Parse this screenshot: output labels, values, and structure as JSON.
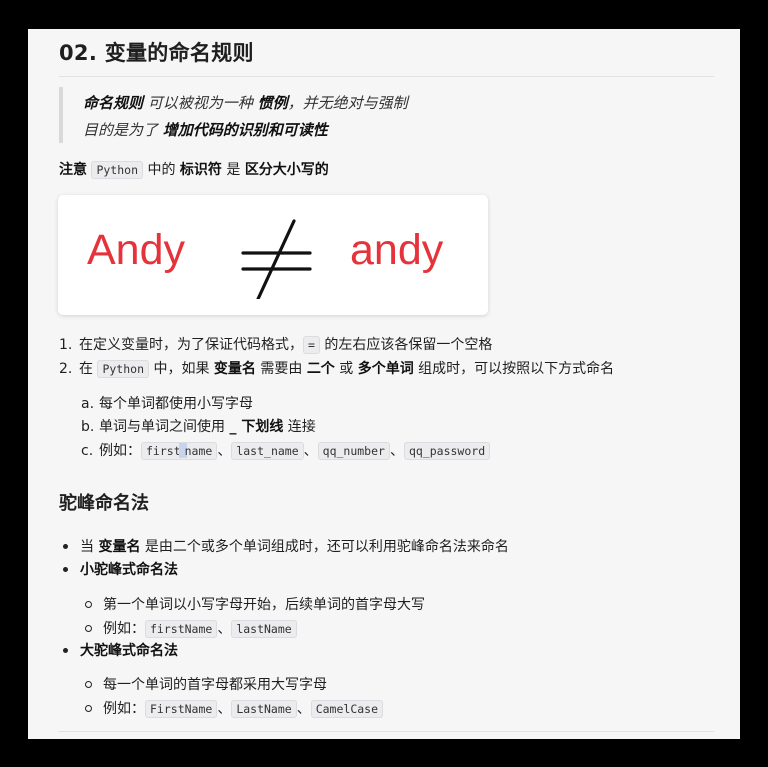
{
  "heading": "02. 变量的命名规则",
  "quote": {
    "l1_b1": "命名规则",
    "l1_t1": " 可以被视为一种 ",
    "l1_b2": "惯例",
    "l1_t2": "，并无绝对与强制",
    "l2_t1": "目的是为了 ",
    "l2_b1": "增加代码的识别和可读性"
  },
  "note": {
    "b1": "注意",
    "code": "Python",
    "t1": " 中的 ",
    "b2": "标识符",
    "t2": " 是 ",
    "b3": "区分大小写的"
  },
  "image": {
    "left_word": "Andy",
    "right_word": "andy",
    "word_color": "#e5333b",
    "symbol_icon": "not-equal-icon"
  },
  "list": {
    "item1": {
      "num": "1.",
      "t1": "在定义变量时，为了保证代码格式，",
      "code": "=",
      "t2": "的左右应该各保留一个空格"
    },
    "item2": {
      "num": "2.",
      "t1": "在 ",
      "code": "Python",
      "t2": " 中，如果 ",
      "b1": "变量名",
      "t3": " 需要由 ",
      "b2": "二个",
      "t4": " 或 ",
      "b3": "多个单词",
      "t5": " 组成时，可以按照以下方式命名"
    },
    "sub_a": {
      "num": "a.",
      "text": "每个单词都使用小写字母"
    },
    "sub_b": {
      "num": "b.",
      "t1": "单词与单词之间使用 ",
      "b1": "_ 下划线",
      "t2": " 连接"
    },
    "sub_c": {
      "num": "c.",
      "t1": "例如：",
      "c1a": "first",
      "c1b": "name",
      "sep": "、",
      "c2": "last_name",
      "c3": "qq_number",
      "c4": "qq_password"
    }
  },
  "section2": {
    "heading": "驼峰命名法",
    "b1": {
      "t1": "当 ",
      "b": "变量名",
      "t2": " 是由二个或多个单词组成时，还可以利用驼峰命名法来命名"
    },
    "b2": "小驼峰式命名法",
    "b2_1": "第一个单词以小写字母开始，后续单词的首字母大写",
    "b2_2": {
      "t1": "例如：",
      "c1": "firstName",
      "sep": "、",
      "c2": "lastName"
    },
    "b3": "大驼峰式命名法",
    "b3_1": "每一个单词的首字母都采用大写字母",
    "b3_2": {
      "t1": "例如：",
      "c1": "FirstName",
      "sep1": "、",
      "c2": "LastName",
      "sep2": "、",
      "c3": "CamelCase"
    }
  }
}
